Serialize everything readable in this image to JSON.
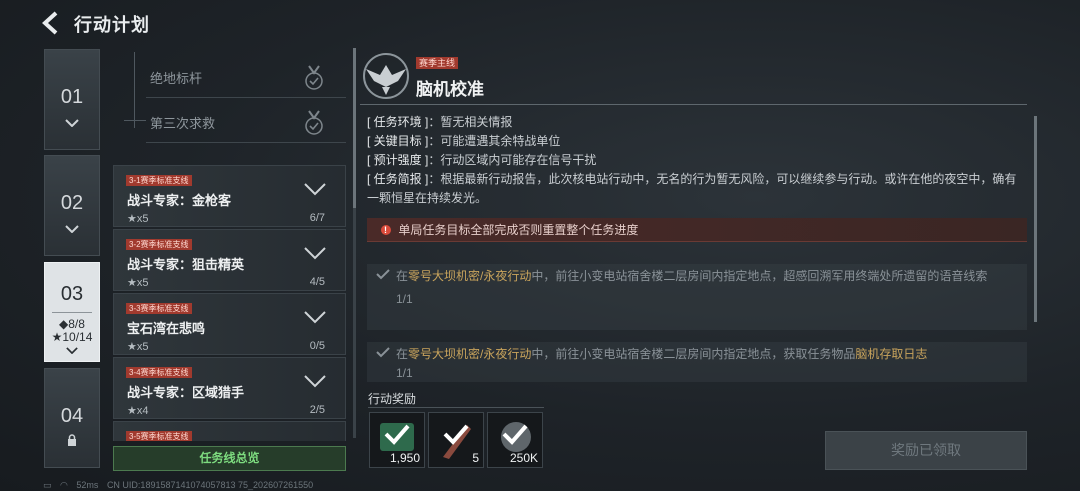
{
  "header": {
    "title": "行动计划"
  },
  "chapters": [
    {
      "num": "01"
    },
    {
      "num": "02"
    },
    {
      "num": "03",
      "stat1": "◆8/8",
      "stat2": "★10/14"
    },
    {
      "num": "04"
    }
  ],
  "sub_objectives": [
    {
      "label": "绝地标杆"
    },
    {
      "label": "第三次求救"
    }
  ],
  "missions": [
    {
      "tag": "3-1赛季标准支线",
      "name": "战斗专家：金枪客",
      "stars": "★x5",
      "progress": "6/7"
    },
    {
      "tag": "3-2赛季标准支线",
      "name": "战斗专家：狙击精英",
      "stars": "★x5",
      "progress": "4/5"
    },
    {
      "tag": "3-3赛季标准支线",
      "name": "宝石湾在悲鸣",
      "stars": "★x5",
      "progress": "0/5"
    },
    {
      "tag": "3-4赛季标准支线",
      "name": "战斗专家：区域猎手",
      "stars": "★x4",
      "progress": "2/5"
    },
    {
      "tag": "3-5赛季标准支线"
    }
  ],
  "summary_button": "任务线总览",
  "status_bar": {
    "ping": "52ms",
    "uid": "CN UID:1891587141074057813 75_202607261550"
  },
  "detail": {
    "season_tag": "赛季主线",
    "title": "脑机校准",
    "info": [
      {
        "key": "[ 任务环境 ]",
        "value": "：暂无相关情报"
      },
      {
        "key": "[ 关键目标 ]",
        "value": "：可能遭遇其余特战单位"
      },
      {
        "key": "[ 预计强度 ]",
        "value": "：行动区域内可能存在信号干扰"
      },
      {
        "key": "[ 任务简报 ]",
        "value": "：根据最新行动报告，此次核电站行动中，无名的行为暂无风险，可以继续参与行动。或许在他的夜空中，确有一颗恒星在持续发光。"
      }
    ],
    "warning": "单局任务目标全部完成否则重置整个任务进度",
    "objectives": [
      {
        "pre": "在",
        "hl1": "零号大坝机密/永夜行动",
        "mid": "中，前往小变电站宿舍楼二层房间内指定地点，超感回溯军用终端处所遗留的语音线索",
        "hl2": "",
        "count": "1/1"
      },
      {
        "pre": "在",
        "hl1": "零号大坝机密/永夜行动",
        "mid": "中，前往小变电站宿舍楼二层房间内指定地点，获取任务物品",
        "hl2": "脑机存取日志",
        "count": "1/1"
      }
    ]
  },
  "rewards": {
    "label": "行动奖励",
    "items": [
      {
        "amount": "1,950",
        "icon": "exp-icon"
      },
      {
        "amount": "5",
        "icon": "knife-icon"
      },
      {
        "amount": "250K",
        "icon": "coin-icon"
      }
    ],
    "claimed_label": "奖励已领取"
  },
  "colors": {
    "accent_red": "#a13a2e",
    "accent_green": "#7ddb7f",
    "highlight_gold": "#c9a45c"
  }
}
